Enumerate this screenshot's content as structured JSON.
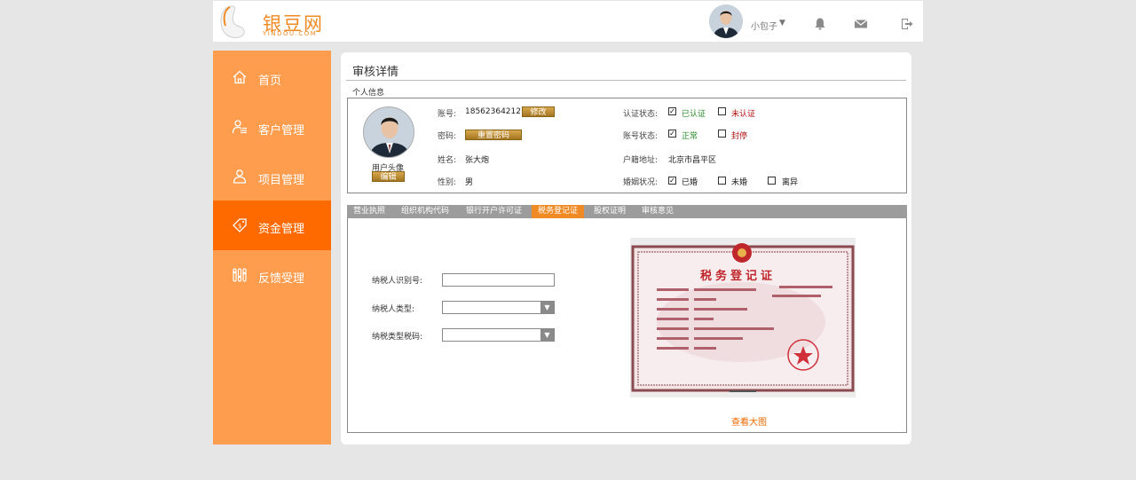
{
  "header": {
    "logo_text": "银豆网",
    "logo_sub": "YINDOU.COM",
    "username": "小包子",
    "caret": "▼",
    "icons": [
      "bell-icon",
      "mail-icon",
      "logout-icon"
    ]
  },
  "colors": {
    "accent": "#ff6a00",
    "sidebar": "#ff9d4f",
    "gold": "#c08f35",
    "tab_active": "#f08a24"
  },
  "sidebar": {
    "items": [
      {
        "label": "首页",
        "icon": "home-icon"
      },
      {
        "label": "客户管理",
        "icon": "user-list-icon"
      },
      {
        "label": "项目管理",
        "icon": "user-icon"
      },
      {
        "label": "资金管理",
        "icon": "money-tag-icon",
        "active": true
      },
      {
        "label": "反馈受理",
        "icon": "sliders-icon"
      }
    ]
  },
  "main": {
    "title": "审核详情",
    "section": "个人信息",
    "profile": {
      "avatar_caption": "用户头像",
      "edit_avatar": "编辑",
      "account_label": "账号:",
      "account_value": "18562364212",
      "modify_button": "修改",
      "password_label": "密码:",
      "reset_password_button": "重置密码",
      "name_label": "姓名:",
      "name_value": "张大炮",
      "gender_label": "性别:",
      "gender_value": "男",
      "auth_label": "认证状态:",
      "auth_verified": "已认证",
      "auth_unverified": "未认证",
      "account_status_label": "账号状态:",
      "status_normal": "正常",
      "status_blocked": "封停",
      "address_label": "户籍地址:",
      "address_value": "北京市昌平区",
      "marital_label": "婚姻状况:",
      "marital_married": "已婚",
      "marital_single": "未婚",
      "marital_divorced": "离异"
    },
    "tabs": [
      {
        "label": "营业执照"
      },
      {
        "label": "组织机构代码"
      },
      {
        "label": "银行开户许可证"
      },
      {
        "label": "税务登记证",
        "active": true
      },
      {
        "label": "股权证明"
      },
      {
        "label": "审核意见"
      }
    ],
    "form": {
      "taxpayer_id_label": "纳税人识别号:",
      "taxpayer_id_value": "",
      "taxpayer_type_label": "纳税人类型:",
      "taxpayer_type_value": "",
      "tax_type_code_label": "纳税类型税码:",
      "tax_type_code_value": ""
    },
    "certificate": {
      "title": "税务登记证",
      "view_large": "查看大图"
    }
  }
}
